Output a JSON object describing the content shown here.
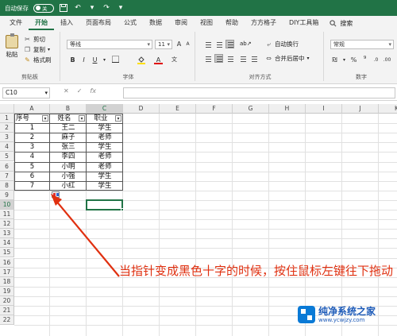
{
  "titlebar": {
    "autosave_label": "自动保存",
    "autosave_state": "关",
    "title": "",
    "search_icon": "search-icon"
  },
  "ribbon_tabs": [
    "文件",
    "开始",
    "插入",
    "页面布局",
    "公式",
    "数据",
    "审阅",
    "视图",
    "帮助",
    "方方格子",
    "DIY工具箱"
  ],
  "ribbon_search": "搜索",
  "clipboard": {
    "paste": "粘贴",
    "cut": "剪切",
    "copy": "复制",
    "format_painter": "格式刷",
    "group_label": "剪贴板"
  },
  "font": {
    "font_name": "等线",
    "font_size": "11",
    "group_label": "字体",
    "bold": "B",
    "italic": "I",
    "underline": "U",
    "increase": "A",
    "decrease": "A"
  },
  "alignment": {
    "wrap_text": "自动换行",
    "merge_center": "合并后居中",
    "group_label": "对齐方式"
  },
  "number": {
    "format": "常规",
    "group_label": "数字"
  },
  "formula_bar": {
    "name_box": "C10",
    "cancel": "✕",
    "enter": "✓",
    "fx": "fx",
    "value": ""
  },
  "grid": {
    "columns": [
      "A",
      "B",
      "C",
      "D",
      "E",
      "F",
      "G",
      "H",
      "I",
      "J",
      "K"
    ],
    "rows": [
      "1",
      "2",
      "3",
      "4",
      "5",
      "6",
      "7",
      "8",
      "9",
      "10",
      "11",
      "12",
      "13",
      "14",
      "15",
      "16",
      "17",
      "18",
      "19",
      "20",
      "21",
      "22"
    ],
    "headers": [
      "序号",
      "姓名",
      "职业"
    ],
    "data": [
      [
        "1",
        "王二",
        "学生"
      ],
      [
        "2",
        "麻子",
        "老师"
      ],
      [
        "3",
        "张三",
        "学生"
      ],
      [
        "4",
        "李四",
        "老师"
      ],
      [
        "5",
        "小明",
        "老师"
      ],
      [
        "6",
        "小强",
        "学生"
      ],
      [
        "7",
        "小红",
        "学生"
      ]
    ]
  },
  "annotation": "当指针变成黑色十字的时候，按住鼠标左键往下拖动",
  "watermark": {
    "title": "纯净系统之家",
    "url": "www.ycwjzy.com"
  },
  "colors": {
    "excel_green": "#217346",
    "annotation_red": "#e03010"
  }
}
